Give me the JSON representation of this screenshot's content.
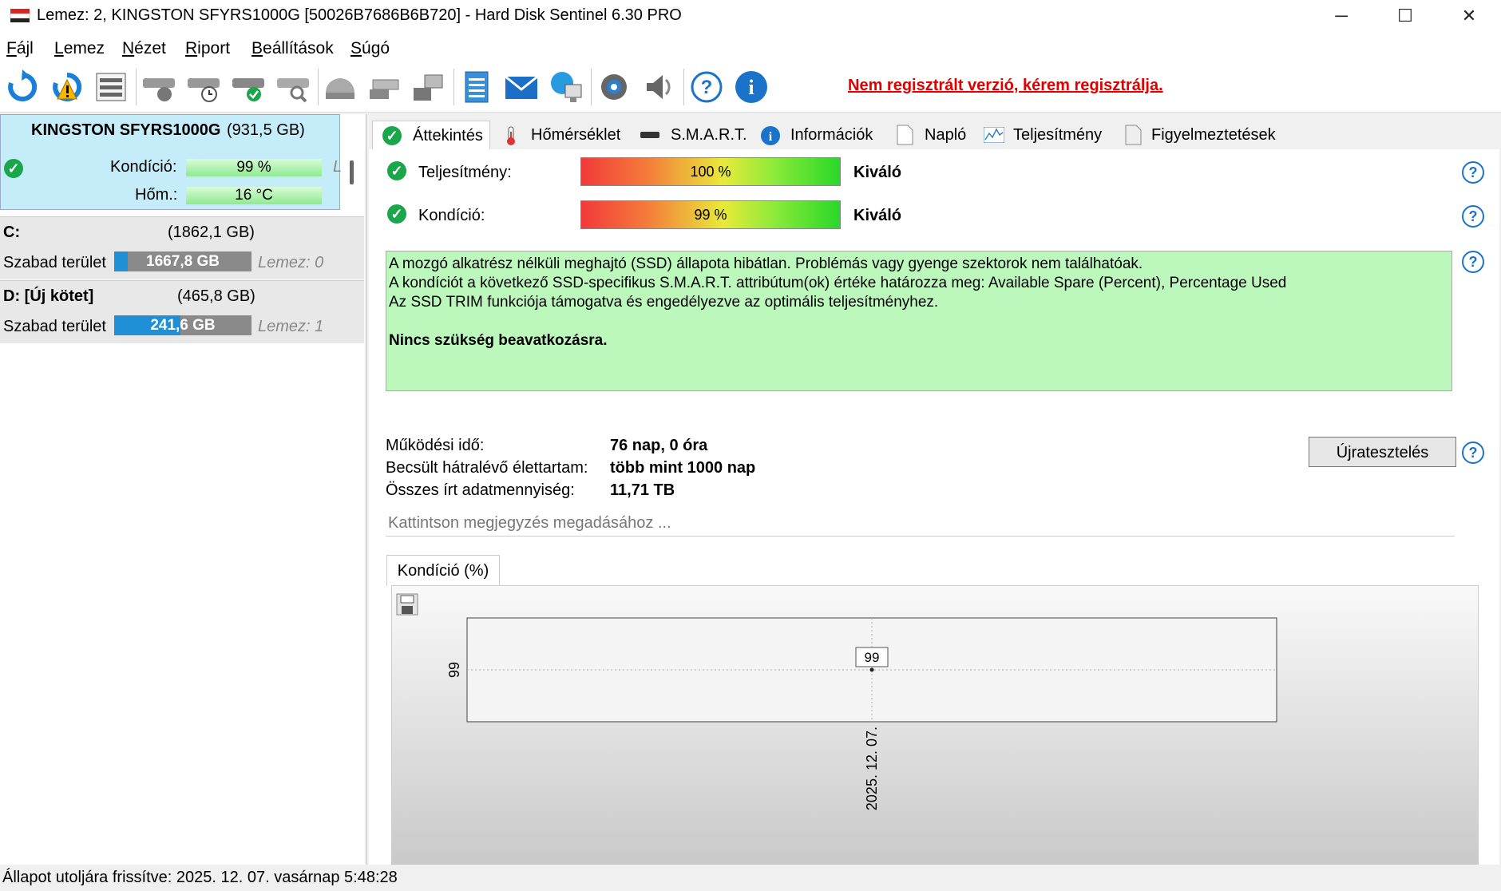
{
  "window": {
    "title": "Lemez: 2, KINGSTON SFYRS1000G [50026B7686B6B720]  -  Hard Disk Sentinel 6.30 PRO",
    "minimize": "─",
    "maximize": "☐",
    "close": "✕"
  },
  "menu": [
    "Fájl",
    "Lemez",
    "Nézet",
    "Riport",
    "Beállítások",
    "Súgó"
  ],
  "toolbar": {
    "icons": [
      "refresh-icon",
      "refresh-warning-icon",
      "disk-list-icon",
      "disk-surface-icon",
      "disk-schedule-icon",
      "disk-check-icon",
      "disk-search-icon",
      "disk-shield-icon",
      "disk-export-icon",
      "disk-transfer-icon",
      "report-icon",
      "mail-icon",
      "network-icon",
      "settings-icon",
      "sound-icon",
      "help-icon",
      "info-icon"
    ],
    "register_text": "Nem regisztrált verzió, kérem regisztrálja."
  },
  "left": {
    "disk": {
      "name": "KINGSTON SFYRS1000G",
      "size": "(931,5 GB)",
      "condition_label": "Kondíció:",
      "condition_value": "99 %",
      "temp_label": "Hőm.:",
      "temp_value": "16 °C",
      "side_letter": "L"
    },
    "partitions": [
      {
        "name": "C:",
        "size": "(1862,1 GB)",
        "free_label": "Szabad terület",
        "free_value": "1667,8 GB",
        "free_fraction": 0.1,
        "disk": "Lemez: 0"
      },
      {
        "name": "D: [Új kötet]",
        "size": "(465,8 GB)",
        "free_label": "Szabad terület",
        "free_value": "241,6 GB",
        "free_fraction": 0.48,
        "disk": "Lemez: 1"
      }
    ]
  },
  "tabs": [
    {
      "label": "Áttekintés",
      "icon": "check-icon"
    },
    {
      "label": "Hőmérséklet",
      "icon": "thermometer-icon"
    },
    {
      "label": "S.M.A.R.T.",
      "icon": "disk-icon"
    },
    {
      "label": "Információk",
      "icon": "info-icon"
    },
    {
      "label": "Napló",
      "icon": "log-icon"
    },
    {
      "label": "Teljesítmény",
      "icon": "performance-icon"
    },
    {
      "label": "Figyelmeztetések",
      "icon": "warnings-icon"
    }
  ],
  "overview": {
    "performance": {
      "label": "Teljesítmény:",
      "value": "100 %",
      "rating": "Kiváló"
    },
    "condition": {
      "label": "Kondíció:",
      "value": "99 %",
      "rating": "Kiváló"
    },
    "status_lines": [
      "A mozgó alkatrész nélküli meghajtó (SSD) állapota hibátlan. Problémás vagy gyenge szektorok nem találhatóak.",
      "A kondíciót a következő SSD-specifikus S.M.A.R.T. attribútum(ok) értéke határozza meg:  Available Spare (Percent), Percentage Used",
      "Az SSD TRIM funkciója támogatva és engedélyezve az optimális teljesítményhez."
    ],
    "status_action": "Nincs szükség beavatkozásra.",
    "uptime_label": "Működési idő:",
    "uptime_value": "76 nap, 0 óra",
    "lifetime_label": "Becsült hátralévő élettartam:",
    "lifetime_value": "több mint 1000 nap",
    "written_label": "Összes írt adatmennyiség:",
    "written_value": "11,71 TB",
    "retest_button": "Újratesztelés",
    "note_placeholder": "Kattintson megjegyzés megadásához ...",
    "chart_tab": "Kondíció  (%)"
  },
  "chart_data": {
    "type": "line",
    "x": [
      "2025. 12. 07."
    ],
    "series": [
      {
        "values": [
          99
        ]
      }
    ],
    "ytick_labels": [
      "99"
    ],
    "data_labels": [
      "99"
    ],
    "grid": true
  },
  "statusbar": "Állapot utoljára frissítve: 2025. 12. 07. vasárnap 5:48:28",
  "colors": {
    "accent": "#1a73c9",
    "status_ok": "#bcf8bc",
    "selected_disk": "#c5ecf9",
    "register": "#e00000"
  }
}
